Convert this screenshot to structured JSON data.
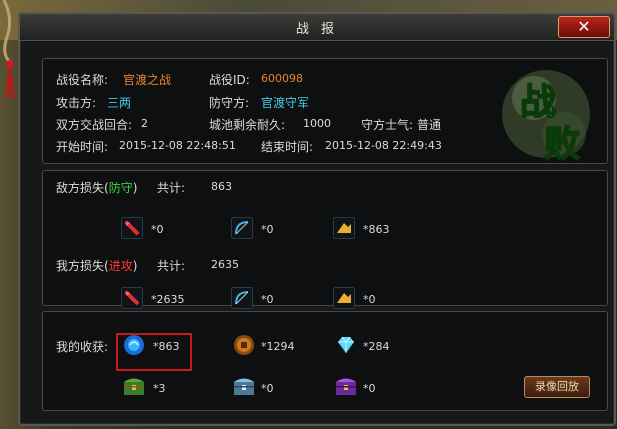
{
  "window": {
    "title": "战 报",
    "close_label": "✕"
  },
  "info": {
    "battle_name_label": "战役名称:",
    "battle_name": "官渡之战",
    "battle_id_label": "战役ID:",
    "battle_id": "600098",
    "attacker_label": "攻击方:",
    "attacker": "三两",
    "defender_label": "防守方:",
    "defender": "官渡守军",
    "rounds_label": "双方交战回合:",
    "rounds": "2",
    "durability_label": "城池剩余耐久:",
    "durability": "1000",
    "morale_label": "守方士气:",
    "morale": "普通",
    "start_label": "开始时间:",
    "start_time": "2015-12-08 22:48:51",
    "end_label": "结束时间:",
    "end_time": "2015-12-08 22:49:43"
  },
  "result_stamp": {
    "text_top": "战",
    "text_bottom": "败"
  },
  "enemy_loss": {
    "label_prefix": "敌方损失",
    "paren_open": "(",
    "role": "防守",
    "paren_close": ")",
    "total_label": "共计:",
    "total": "863",
    "items": [
      {
        "icon": "spear-icon",
        "count": "*0"
      },
      {
        "icon": "bow-icon",
        "count": "*0"
      },
      {
        "icon": "cavalry-icon",
        "count": "*863"
      }
    ]
  },
  "my_loss": {
    "label_prefix": "我方损失",
    "paren_open": "(",
    "role": "进攻",
    "paren_close": ")",
    "total_label": "共计:",
    "total": "2635",
    "items": [
      {
        "icon": "spear-icon",
        "count": "*2635"
      },
      {
        "icon": "bow-icon",
        "count": "*0"
      },
      {
        "icon": "cavalry-icon",
        "count": "*0"
      }
    ]
  },
  "rewards": {
    "label": "我的收获:",
    "items": [
      {
        "icon": "blue-orb-icon",
        "count": "*863"
      },
      {
        "icon": "copper-coin-icon",
        "count": "*1294"
      },
      {
        "icon": "diamond-icon",
        "count": "*284"
      },
      {
        "icon": "green-chest-icon",
        "count": "*3"
      },
      {
        "icon": "silver-chest-icon",
        "count": "*0"
      },
      {
        "icon": "purple-chest-icon",
        "count": "*0"
      }
    ]
  },
  "replay_button": "录像回放",
  "colors": {
    "orange": "#e8862a",
    "cyan": "#48c8e8",
    "green": "#3cd24a",
    "red": "#ff3a2a",
    "highlight": "#c81818"
  }
}
